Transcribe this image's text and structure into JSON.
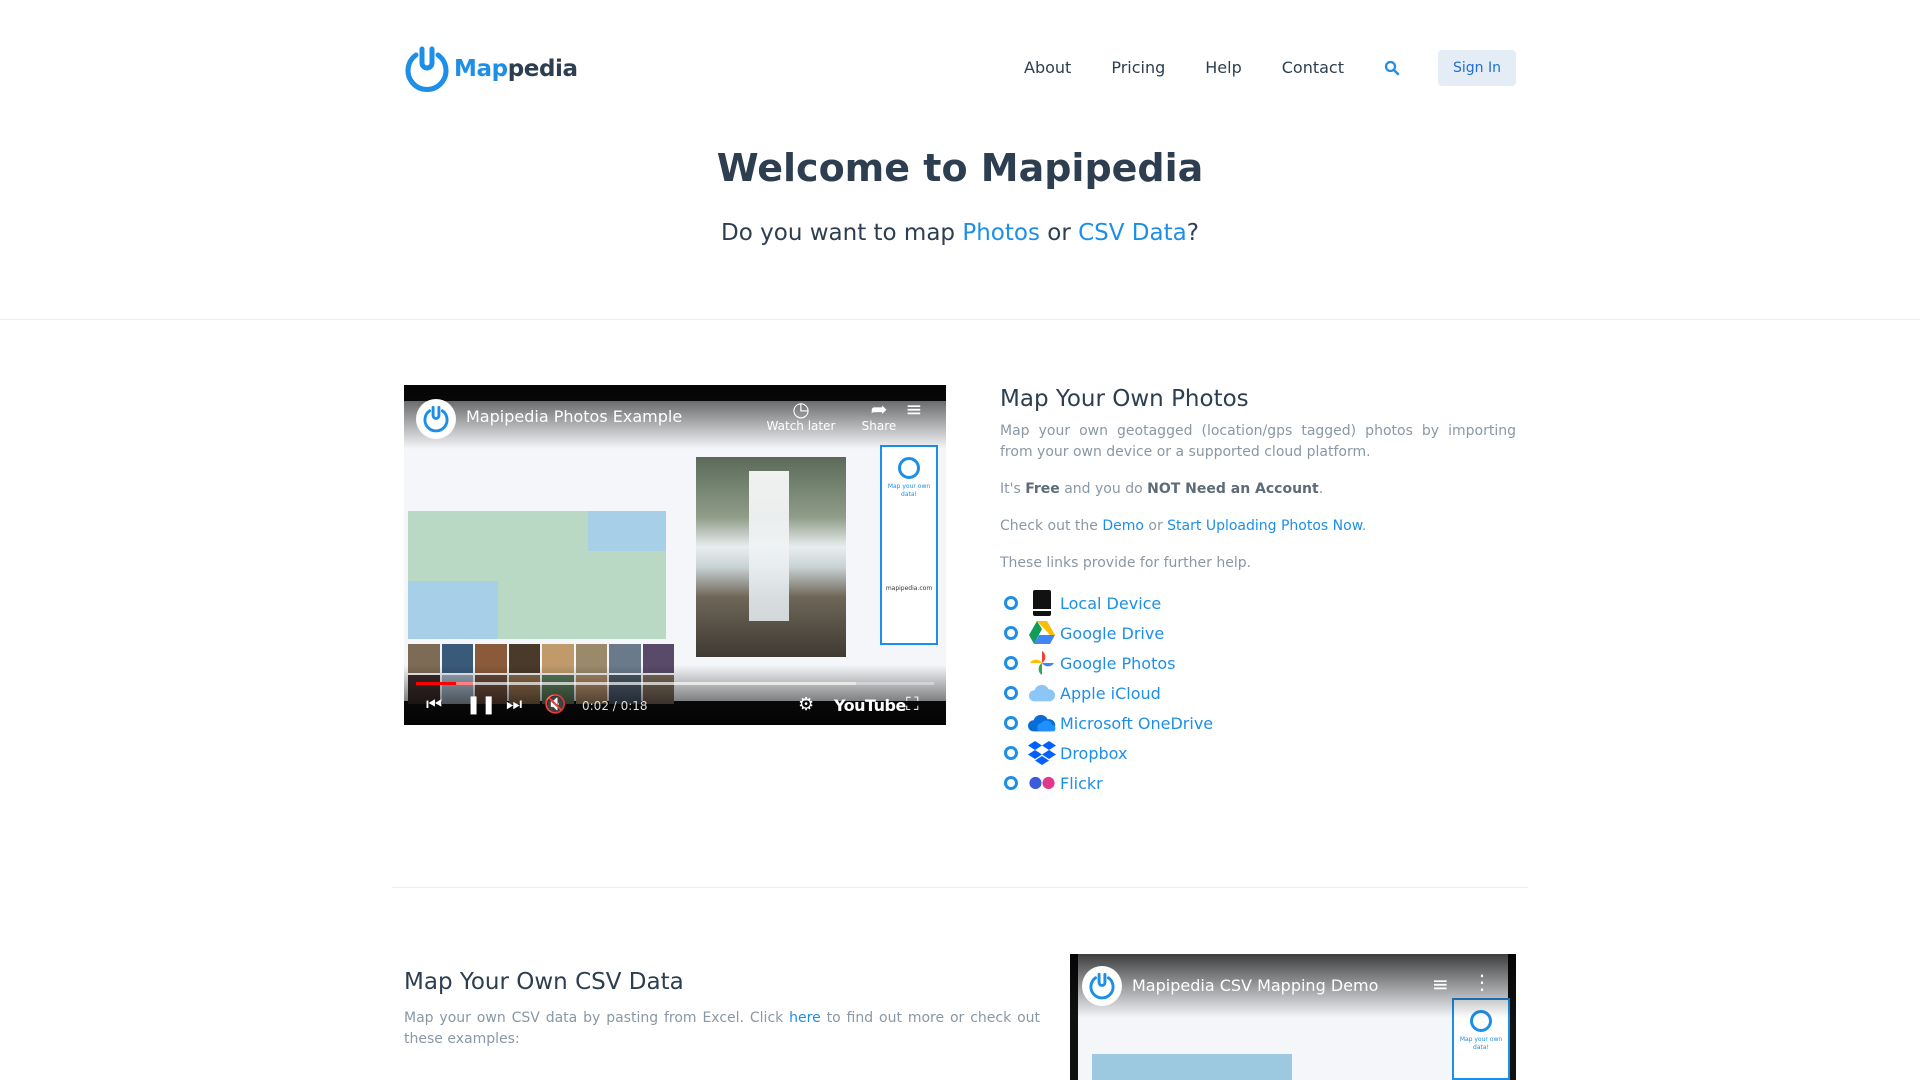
{
  "brand": {
    "name_part1": "Map",
    "name_part2": "pedia",
    "accent": "#1e8fe8",
    "text": "#2d3e50"
  },
  "nav": {
    "items": [
      "About",
      "Pricing",
      "Help",
      "Contact"
    ],
    "search_icon": "search-icon",
    "signin_label": "Sign In"
  },
  "hero": {
    "title": "Welcome to Mapipedia",
    "sub_prefix": "Do you want to map ",
    "sub_link1": "Photos",
    "sub_mid": " or ",
    "sub_link2": "CSV Data",
    "sub_suffix": "?"
  },
  "video1": {
    "title": "Mapipedia Photos Example",
    "watch_later": "Watch later",
    "share": "Share",
    "time": "0:02 / 0:18",
    "youtube": "YouTube",
    "progress": 0.11,
    "panel_text": "Map your own data!",
    "panel_site": "mapipedia.com"
  },
  "photos_section": {
    "heading": "Map Your Own Photos",
    "p1": "Map your own geotagged (location/gps tagged) photos by importing from your own device or a supported cloud platform.",
    "p2_prefix": "It's ",
    "p2_bold1": "Free",
    "p2_mid": " and you do ",
    "p2_bold2": "NOT Need an Account",
    "p2_suffix": ".",
    "p3_prefix": "Check out the ",
    "p3_link1": "Demo",
    "p3_mid": " or ",
    "p3_link2": "Start Uploading Photos Now",
    "p3_suffix": ".",
    "p4": "These links provide for further help.",
    "services": [
      {
        "label": "Local Device",
        "icon": "local-device-icon"
      },
      {
        "label": "Google Drive",
        "icon": "google-drive-icon"
      },
      {
        "label": "Google Photos",
        "icon": "google-photos-icon"
      },
      {
        "label": "Apple iCloud",
        "icon": "icloud-icon"
      },
      {
        "label": "Microsoft OneDrive",
        "icon": "onedrive-icon"
      },
      {
        "label": "Dropbox",
        "icon": "dropbox-icon"
      },
      {
        "label": "Flickr",
        "icon": "flickr-icon"
      }
    ]
  },
  "csv_section": {
    "heading": "Map Your Own CSV Data",
    "p1_prefix": "Map your own CSV data by pasting from Excel. Click ",
    "p1_link": "here",
    "p1_suffix": " to find out more or check out these examples:",
    "video_title": "Mapipedia CSV Mapping Demo"
  }
}
